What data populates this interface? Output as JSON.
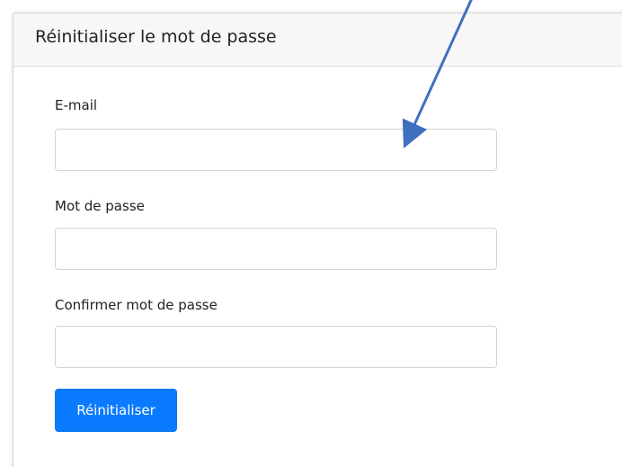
{
  "form": {
    "title": "Réinitialiser le mot de passe",
    "email_label": "E-mail",
    "email_value": "",
    "password_label": "Mot de passe",
    "password_value": "",
    "confirm_label": "Confirmer mot de passe",
    "confirm_value": "",
    "submit_label": "Réinitialiser"
  },
  "colors": {
    "primary_button": "#0a7bff",
    "annotation_arrow": "#3f6fbf"
  },
  "icons": {
    "annotation": "arrow-annotation-icon"
  }
}
